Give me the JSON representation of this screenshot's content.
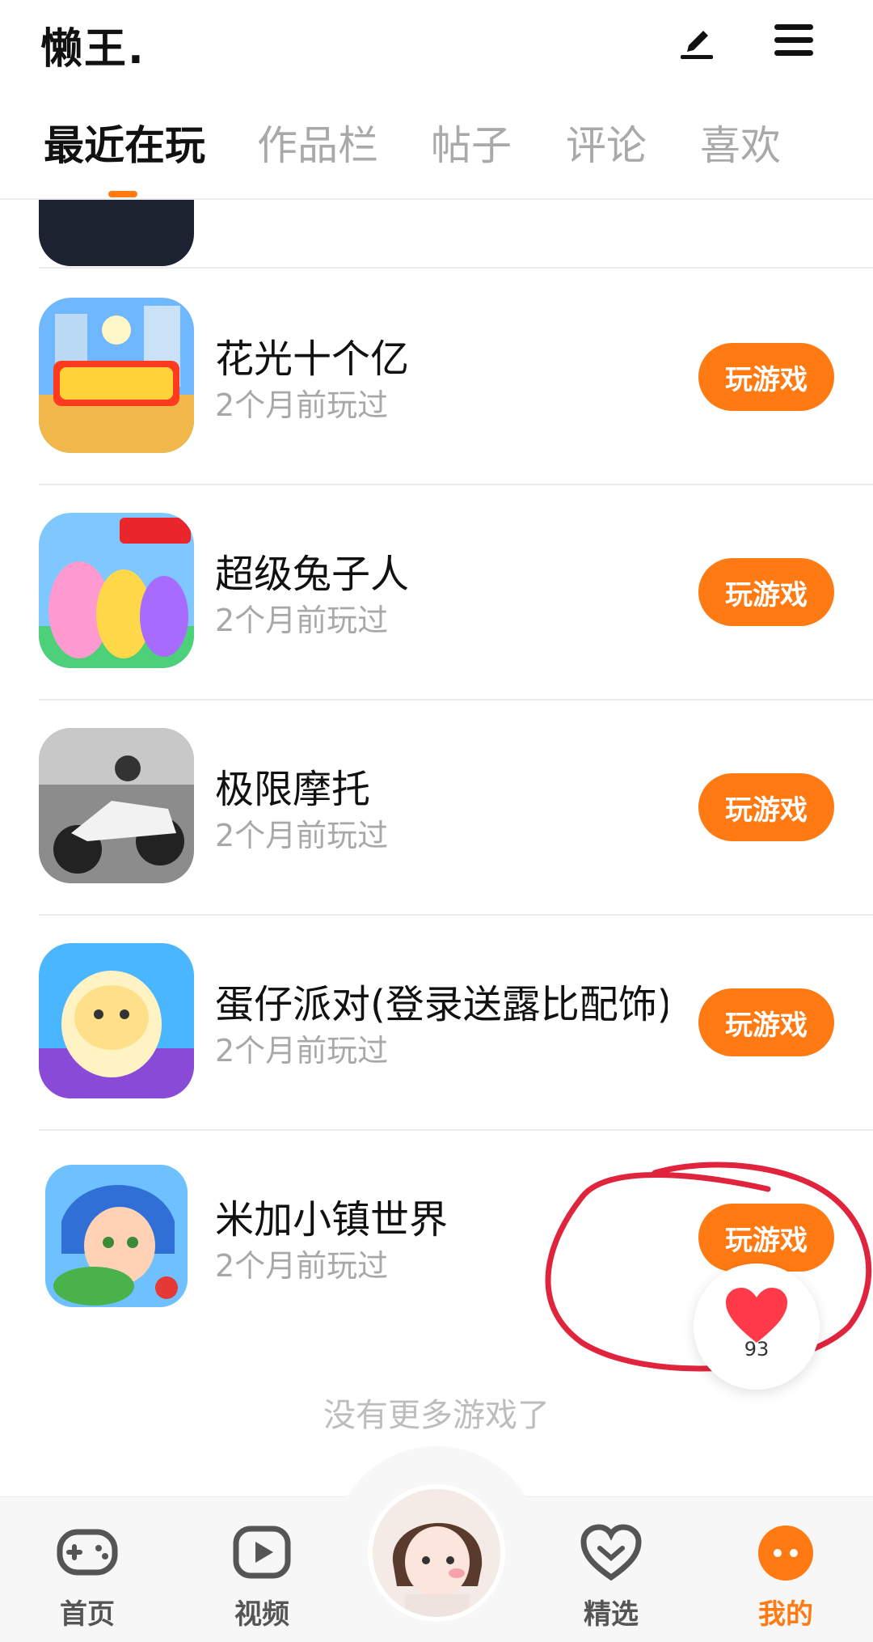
{
  "header": {
    "username": "懒王."
  },
  "tabs": [
    {
      "label": "最近在玩"
    },
    {
      "label": "作品栏"
    },
    {
      "label": "帖子"
    },
    {
      "label": "评论"
    },
    {
      "label": "喜欢"
    }
  ],
  "games": [
    {
      "name": "花光十个亿",
      "time": "2个月前玩过",
      "button": "玩游戏",
      "icon": "game-icon-huaguang"
    },
    {
      "name": "超级兔子人",
      "time": "2个月前玩过",
      "button": "玩游戏",
      "icon": "game-icon-rabbit"
    },
    {
      "name": "极限摩托",
      "time": "2个月前玩过",
      "button": "玩游戏",
      "icon": "game-icon-moto"
    },
    {
      "name": "蛋仔派对(登录送露比配饰)",
      "time": "2个月前玩过",
      "button": "玩游戏",
      "icon": "game-icon-eggy"
    },
    {
      "name": "米加小镇世界",
      "time": "2个月前玩过",
      "button": "玩游戏",
      "icon": "game-icon-miga"
    }
  ],
  "list_footer": "没有更多游戏了",
  "like": {
    "count": "93"
  },
  "bottom_nav": [
    {
      "label": "首页",
      "icon": "gamepad-icon"
    },
    {
      "label": "视频",
      "icon": "video-icon"
    },
    {
      "label": "精选",
      "icon": "heart-icon"
    },
    {
      "label": "我的",
      "icon": "profile-icon",
      "active": true
    }
  ],
  "colors": {
    "accent": "#ff7a12",
    "annotation": "#e0243e"
  }
}
